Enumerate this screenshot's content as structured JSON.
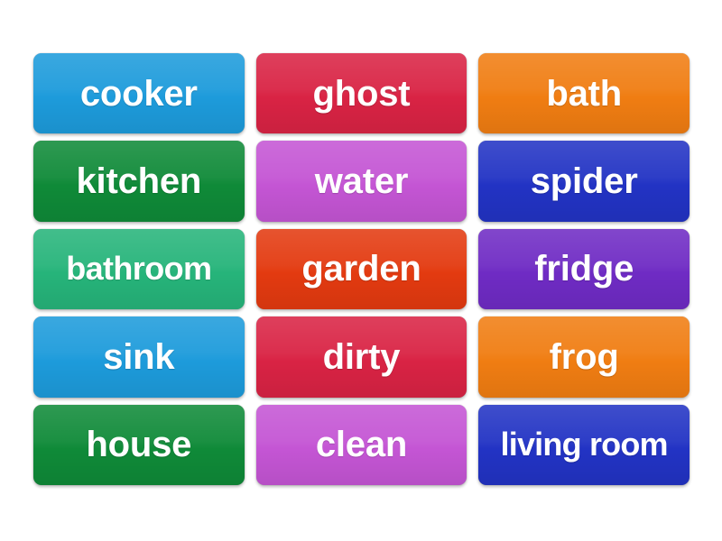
{
  "board": {
    "name": "word-card-board",
    "columns": 3,
    "rows": 5,
    "background_color": "#ffffff",
    "text_color": "#ffffff"
  },
  "palette": {
    "azure": "#1d9bdb",
    "crimson": "#d92344",
    "orange": "#f07d12",
    "dark_green": "#0f8a38",
    "orchid": "#c455d4",
    "royal_blue": "#2233c4",
    "emerald": "#26b47a",
    "orange_red": "#e33a10",
    "violet": "#6f2bc4"
  },
  "cards": [
    {
      "label": "cooker",
      "color": "#1d9bdb",
      "color_name": "azure",
      "row": 1,
      "column": 1,
      "size": "normal"
    },
    {
      "label": "ghost",
      "color": "#d92344",
      "color_name": "crimson",
      "row": 1,
      "column": 2,
      "size": "normal"
    },
    {
      "label": "bath",
      "color": "#f07d12",
      "color_name": "orange",
      "row": 1,
      "column": 3,
      "size": "normal"
    },
    {
      "label": "kitchen",
      "color": "#0f8a38",
      "color_name": "dark_green",
      "row": 2,
      "column": 1,
      "size": "normal"
    },
    {
      "label": "water",
      "color": "#c455d4",
      "color_name": "orchid",
      "row": 2,
      "column": 2,
      "size": "normal"
    },
    {
      "label": "spider",
      "color": "#2233c4",
      "color_name": "royal_blue",
      "row": 2,
      "column": 3,
      "size": "normal"
    },
    {
      "label": "bathroom",
      "color": "#26b47a",
      "color_name": "emerald",
      "row": 3,
      "column": 1,
      "size": "long"
    },
    {
      "label": "garden",
      "color": "#e33a10",
      "color_name": "orange_red",
      "row": 3,
      "column": 2,
      "size": "normal"
    },
    {
      "label": "fridge",
      "color": "#6f2bc4",
      "color_name": "violet",
      "row": 3,
      "column": 3,
      "size": "normal"
    },
    {
      "label": "sink",
      "color": "#1d9bdb",
      "color_name": "azure",
      "row": 4,
      "column": 1,
      "size": "normal"
    },
    {
      "label": "dirty",
      "color": "#d92344",
      "color_name": "crimson",
      "row": 4,
      "column": 2,
      "size": "normal"
    },
    {
      "label": "frog",
      "color": "#f07d12",
      "color_name": "orange",
      "row": 4,
      "column": 3,
      "size": "normal"
    },
    {
      "label": "house",
      "color": "#0f8a38",
      "color_name": "dark_green",
      "row": 5,
      "column": 1,
      "size": "normal"
    },
    {
      "label": "clean",
      "color": "#c455d4",
      "color_name": "orchid",
      "row": 5,
      "column": 2,
      "size": "normal"
    },
    {
      "label": "living room",
      "color": "#2233c4",
      "color_name": "royal_blue",
      "row": 5,
      "column": 3,
      "size": "xlong"
    }
  ]
}
